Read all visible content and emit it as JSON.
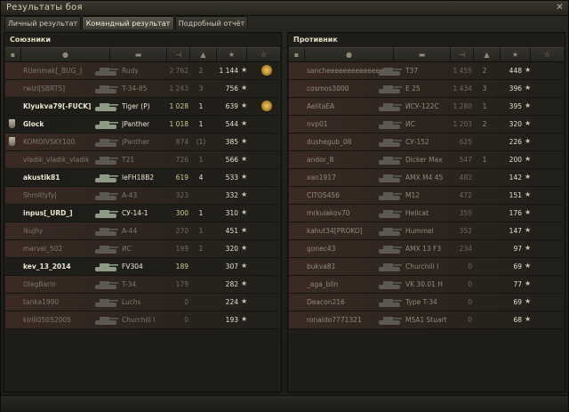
{
  "window": {
    "title": "Результаты боя",
    "close_glyph": "✕"
  },
  "tabs": [
    {
      "label": "Личный результат"
    },
    {
      "label": "Командный результат",
      "active": true
    },
    {
      "label": "Подробный отчёт"
    }
  ],
  "allies": {
    "title": "Союзники",
    "rows": [
      {
        "name": "RUenmak[_BUG_]",
        "vehicle": "Rudy",
        "damage": "2 762",
        "kills": "2",
        "xp": "1 144",
        "medal": true,
        "dead": true
      },
      {
        "name": "rwizl[SBRTS]",
        "vehicle": "T-34-85",
        "damage": "1 243",
        "kills": "3",
        "xp": "756",
        "dead": true
      },
      {
        "name": "Klyukva79[-FUCK]",
        "vehicle": "Tiger (P)",
        "damage": "1 028",
        "kills": "1",
        "xp": "639",
        "medal": true,
        "alive": true
      },
      {
        "name": "Glock",
        "vehicle": "JPanther",
        "damage": "1 018",
        "kills": "1",
        "xp": "544",
        "platoon": true,
        "alive": true
      },
      {
        "name": "KOMDIVSKY100",
        "vehicle": "JPanther",
        "damage": "874",
        "kills": "(1)",
        "xp": "385",
        "platoon": true,
        "dead": true
      },
      {
        "name": "vladik_vladik_vladik",
        "vehicle": "T21",
        "damage": "726",
        "kills": "1",
        "xp": "566",
        "dead": true
      },
      {
        "name": "akustik81",
        "vehicle": "leFH18B2",
        "damage": "619",
        "kills": "4",
        "xp": "533",
        "alive": true
      },
      {
        "name": "Shmitlyfyj",
        "vehicle": "A-43",
        "damage": "323",
        "kills": "",
        "xp": "332",
        "dead": true
      },
      {
        "name": "inpus[_URD_]",
        "vehicle": "СУ-14-1",
        "damage": "300",
        "kills": "1",
        "xp": "310",
        "alive": true
      },
      {
        "name": "Ikujhy",
        "vehicle": "A-44",
        "damage": "270",
        "kills": "1",
        "xp": "451",
        "dead": true
      },
      {
        "name": "marvel_502",
        "vehicle": "ИС",
        "damage": "199",
        "kills": "1",
        "xp": "320",
        "dead": true
      },
      {
        "name": "kev_13_2014",
        "vehicle": "FV304",
        "damage": "189",
        "kills": "",
        "xp": "307",
        "alive": true
      },
      {
        "name": "OlegBarin",
        "vehicle": "T-34",
        "damage": "179",
        "kills": "",
        "xp": "282",
        "dead": true
      },
      {
        "name": "tanka1990",
        "vehicle": "Luchs",
        "damage": "0",
        "kills": "",
        "xp": "224",
        "dead": true
      },
      {
        "name": "kirill05052005",
        "vehicle": "Churchill I",
        "damage": "0",
        "kills": "",
        "xp": "193",
        "dead": true
      }
    ]
  },
  "enemies": {
    "title": "Противник",
    "rows": [
      {
        "name": "sancheeeeeeeeeeeeeeeeeeeeeeeee",
        "vehicle": "T37",
        "damage": "1 455",
        "kills": "2",
        "xp": "448"
      },
      {
        "name": "cosmos3000",
        "vehicle": "E 25",
        "damage": "1 434",
        "kills": "3",
        "xp": "396"
      },
      {
        "name": "AelitaEA",
        "vehicle": "ИСУ-122С",
        "damage": "1 280",
        "kills": "1",
        "xp": "395"
      },
      {
        "name": "nvp01",
        "vehicle": "ИС",
        "damage": "1 203",
        "kills": "2",
        "xp": "320"
      },
      {
        "name": "dushegub_08",
        "vehicle": "СУ-152",
        "damage": "625",
        "kills": "",
        "xp": "226"
      },
      {
        "name": "andor_8",
        "vehicle": "Dicker Max",
        "damage": "547",
        "kills": "1",
        "xp": "200"
      },
      {
        "name": "xan1917",
        "vehicle": "AMX M4 45",
        "damage": "482",
        "kills": "",
        "xp": "142"
      },
      {
        "name": "CITOS456",
        "vehicle": "M12",
        "damage": "472",
        "kills": "",
        "xp": "151"
      },
      {
        "name": "mrkulakov70",
        "vehicle": "Hellcat",
        "damage": "355",
        "kills": "",
        "xp": "176"
      },
      {
        "name": "kahut34[PROKO]",
        "vehicle": "Hummel",
        "damage": "352",
        "kills": "",
        "xp": "147"
      },
      {
        "name": "gonec43",
        "vehicle": "AMX 13 F3",
        "damage": "234",
        "kills": "",
        "xp": "97"
      },
      {
        "name": "bukva81",
        "vehicle": "Churchill I",
        "damage": "0",
        "kills": "",
        "xp": "69"
      },
      {
        "name": "_aga_blin",
        "vehicle": "VK 30.01 H",
        "damage": "0",
        "kills": "",
        "xp": "77"
      },
      {
        "name": "Deacon216",
        "vehicle": "Type T-34",
        "damage": "0",
        "kills": "",
        "xp": "69"
      },
      {
        "name": "ronaldo7771321",
        "vehicle": "M5A1 Stuart",
        "damage": "0",
        "kills": "",
        "xp": "68"
      }
    ]
  },
  "colors": {
    "dead_text": "#7d786a",
    "alive_text": "#ece7d2",
    "enemy_text": "#8f8a7b",
    "dead_row_bg": "#3a2a23",
    "alive_row_bg": "#1e1d19",
    "dmg_alive": "#d7c98f"
  }
}
